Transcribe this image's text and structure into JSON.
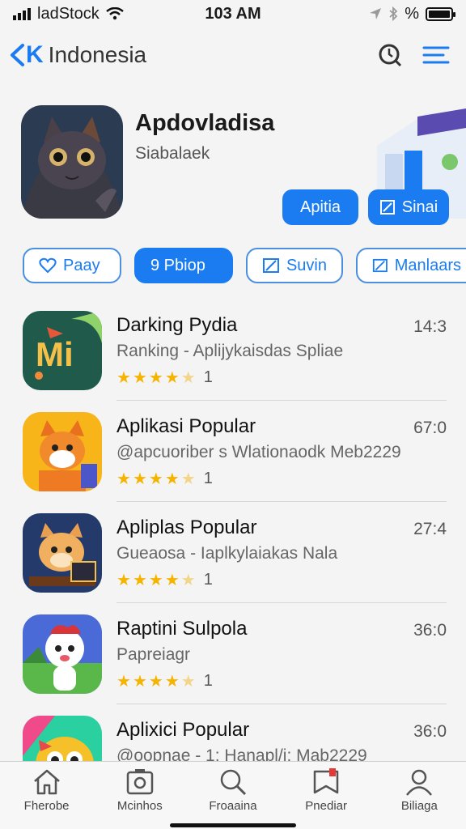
{
  "status": {
    "carrier": "ladStock",
    "time": "103 AM",
    "right_text": "%"
  },
  "nav": {
    "back_label": "K",
    "title": "Indonesia",
    "icons": [
      "clock-search-icon",
      "menu-lines-icon"
    ]
  },
  "featured": {
    "title": "Apdovladisa",
    "subtitle": "Siabalaek",
    "buttons": [
      {
        "label": "Apitia"
      },
      {
        "label": "Sinai",
        "icon": "edit-icon"
      }
    ]
  },
  "chips": [
    {
      "label": "Paay",
      "icon": "heart-icon",
      "active": false
    },
    {
      "label": "9 Pbiop",
      "active": true
    },
    {
      "label": "Suvin",
      "icon": "edit-icon",
      "active": false
    },
    {
      "label": "Manlaars",
      "icon": "edit-icon",
      "active": false
    }
  ],
  "apps": [
    {
      "name": "Darking Pydia",
      "desc": "Ranking - Aplijykaisdas Spliae",
      "rating_count": "1",
      "meta": "14:3",
      "stars": 4.5
    },
    {
      "name": "Aplikasi Popular",
      "desc": "@apcuoriber s Wlationaodk Meb2229",
      "rating_count": "1",
      "meta": "67:0",
      "stars": 4.5
    },
    {
      "name": "Apliplas Popular",
      "desc": "Gueaosa - Iaplkylaiakas Nala",
      "rating_count": "1",
      "meta": "27:4",
      "stars": 4.5
    },
    {
      "name": "Raptini Sulpola",
      "desc": "Papreiagr",
      "rating_count": "1",
      "meta": "36:0",
      "stars": 4.5
    },
    {
      "name": "Aplixici Popular",
      "desc": "@oopnae - 1:      Hanapl/i: Mab2229",
      "rating_count": "",
      "meta": "36:0",
      "stars": 0
    }
  ],
  "tabs": [
    {
      "label": "Fherobe",
      "icon": "home-icon"
    },
    {
      "label": "Mcinhos",
      "icon": "camera-icon"
    },
    {
      "label": "Froaaina",
      "icon": "search-icon"
    },
    {
      "label": "Pnediar",
      "icon": "bookmark-icon"
    },
    {
      "label": "Biliaga",
      "icon": "person-icon"
    }
  ],
  "colors": {
    "accent": "#1a7cf0",
    "star": "#f5b400"
  }
}
